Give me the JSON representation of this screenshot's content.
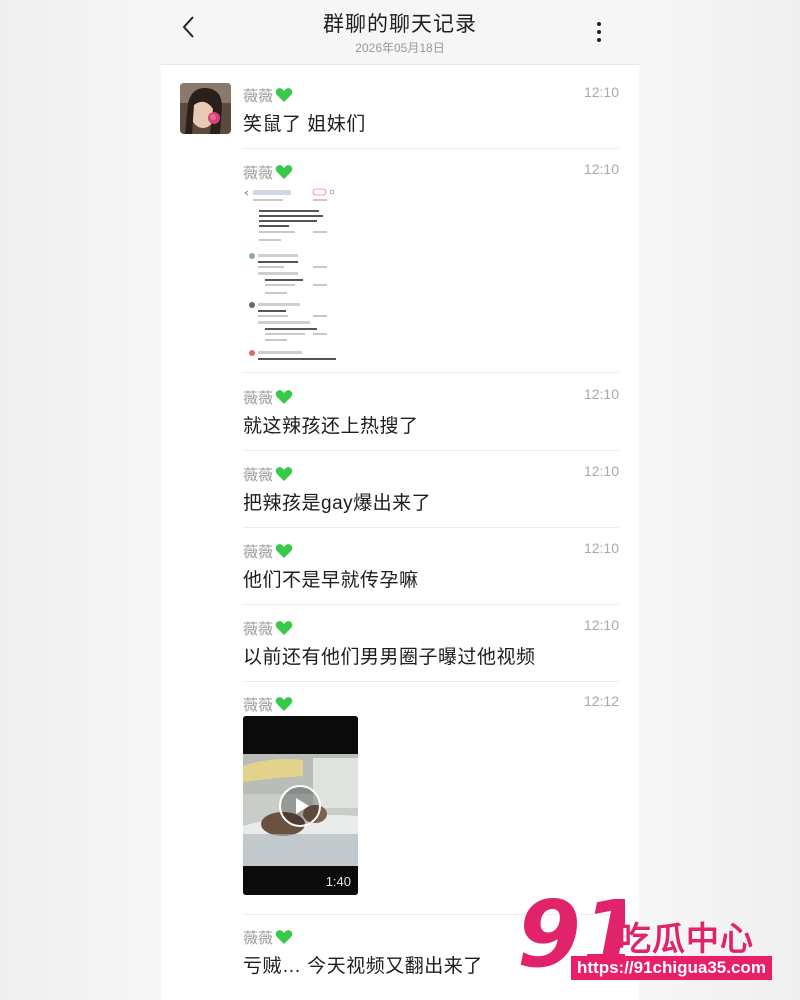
{
  "header": {
    "title": "群聊的聊天记录",
    "date": "2026年05月18日",
    "back_icon": "chevron-left-icon",
    "more_icon": "vertical-dots-icon"
  },
  "messages": [
    {
      "sender": "薇薇",
      "time": "12:10",
      "text": "笑鼠了 姐妹们"
    },
    {
      "sender": "薇薇",
      "time": "12:10",
      "attachment": "screenshot-image"
    },
    {
      "sender": "薇薇",
      "time": "12:10",
      "text": "就这辣孩还上热搜了"
    },
    {
      "sender": "薇薇",
      "time": "12:10",
      "text": "把辣孩是gay爆出来了"
    },
    {
      "sender": "薇薇",
      "time": "12:10",
      "text": "他们不是早就传孕嘛"
    },
    {
      "sender": "薇薇",
      "time": "12:10",
      "text": "以前还有他们男男圈子曝过他视频"
    },
    {
      "sender": "薇薇",
      "time": "12:12",
      "attachment": "video",
      "duration": "1:40"
    },
    {
      "sender": "薇薇",
      "time": "",
      "text": "亏贼… 今天视频又翻出来了"
    }
  ],
  "watermark": {
    "number": "91",
    "brand": "吃瓜中心",
    "url": "https://91chigua35.com"
  },
  "colors": {
    "heart": "#36c94a",
    "watermark": "#e0236b"
  }
}
